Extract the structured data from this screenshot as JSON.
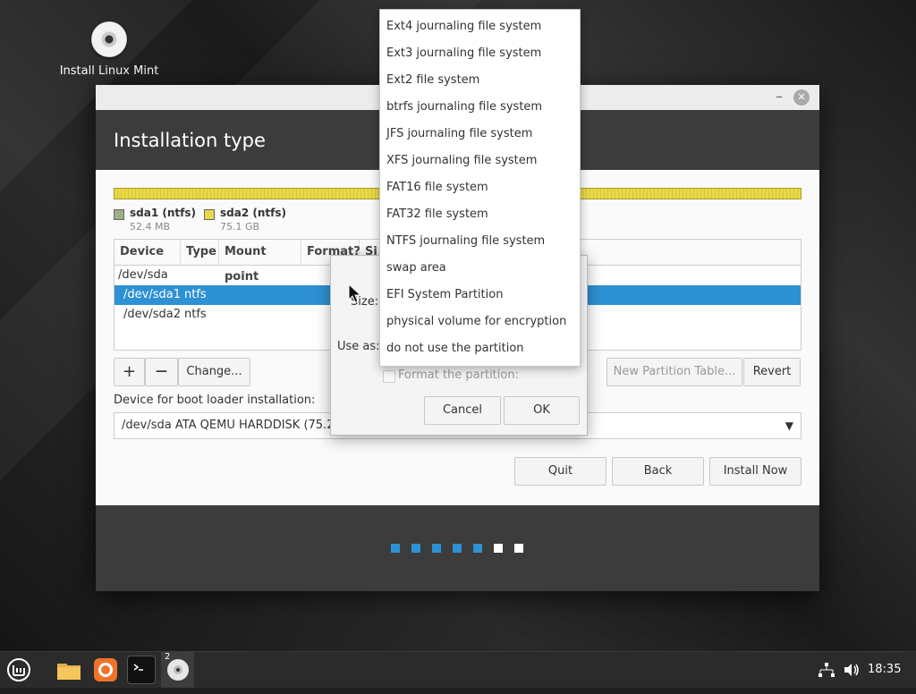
{
  "desktop": {
    "icon_label": "Install Linux Mint"
  },
  "window": {
    "title": "Installation type",
    "legend": [
      {
        "name": "sda1 (ntfs)",
        "size": "52.4 MB",
        "color": "#9caf88"
      },
      {
        "name": "sda2 (ntfs)",
        "size": "75.1 GB",
        "color": "#e9d94a"
      }
    ],
    "table": {
      "headers": [
        "Device",
        "Type",
        "Mount point",
        "Format?",
        "Si"
      ],
      "rows": [
        {
          "device": "/dev/sda",
          "type": ""
        },
        {
          "device": "/dev/sda1",
          "type": "ntfs"
        },
        {
          "device": "/dev/sda2",
          "type": "ntfs"
        }
      ]
    },
    "buttons": {
      "add": "+",
      "remove": "—",
      "change": "Change...",
      "new_table": "New Partition Table...",
      "revert": "Revert",
      "quit": "Quit",
      "back": "Back",
      "install": "Install Now"
    },
    "bootloader_label": "Device for boot loader installation:",
    "bootloader_value": "/dev/sda   ATA QEMU HARDDISK (75.2",
    "progress": {
      "total_steps": 7,
      "completed": 5
    }
  },
  "dialog": {
    "size_label": "Size:",
    "use_as_label": "Use as:",
    "format_label": "Format the partition:",
    "cancel": "Cancel",
    "ok": "OK"
  },
  "dropdown": {
    "options": [
      "Ext4 journaling file system",
      "Ext3 journaling file system",
      "Ext2 file system",
      "btrfs journaling file system",
      "JFS journaling file system",
      "XFS journaling file system",
      "FAT16 file system",
      "FAT32 file system",
      "NTFS journaling file system",
      "swap area",
      "EFI System Partition",
      "physical volume for encryption",
      "do not use the partition"
    ]
  },
  "taskbar": {
    "badge": "2",
    "clock": "18:35",
    "icons": [
      "mint-menu-icon",
      "files-icon",
      "firefox-icon",
      "terminal-icon",
      "installer-icon"
    ]
  }
}
